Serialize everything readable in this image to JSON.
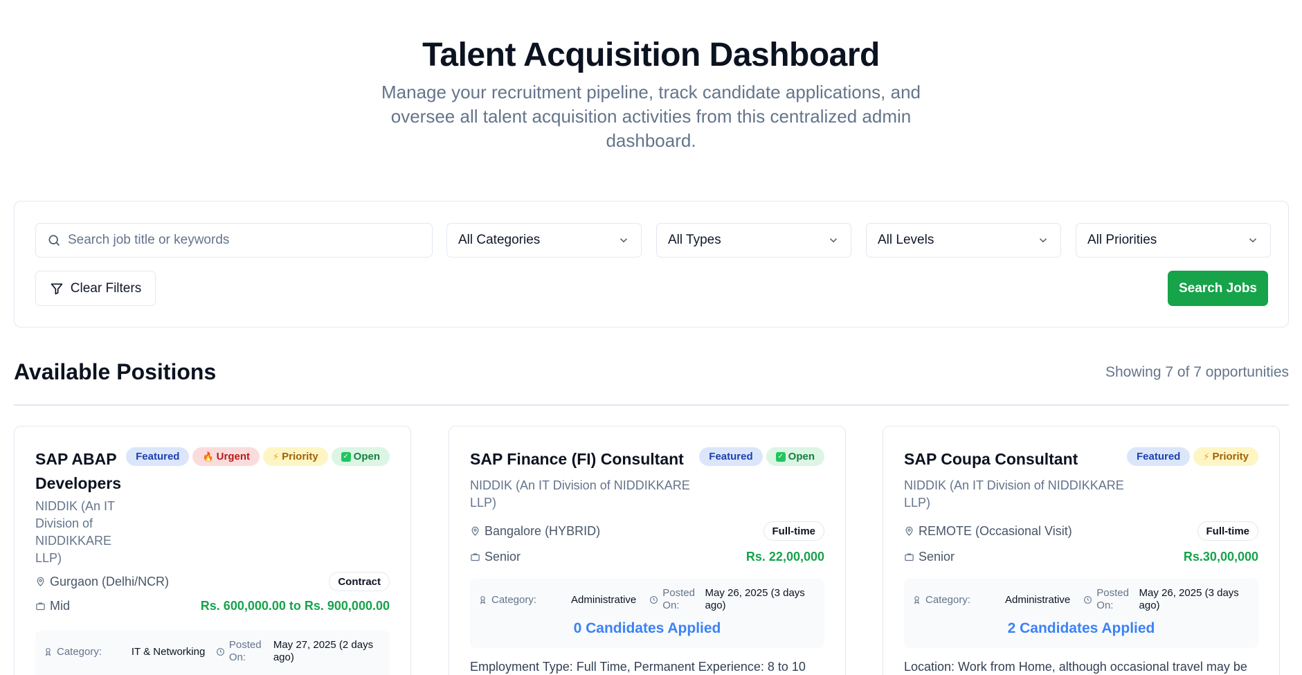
{
  "header": {
    "title": "Talent Acquisition Dashboard",
    "subtitle": "Manage your recruitment pipeline, track candidate applications, and oversee all talent acquisition activities from this centralized admin dashboard."
  },
  "filters": {
    "search_placeholder": "Search job title or keywords",
    "category": "All Categories",
    "type": "All Types",
    "level": "All Levels",
    "priority": "All Priorities",
    "clear_label": "Clear Filters",
    "search_label": "Search Jobs"
  },
  "positions": {
    "heading": "Available Positions",
    "count_text": "Showing 7 of 7 opportunities"
  },
  "labels": {
    "category": "Category:",
    "posted": "Posted On:"
  },
  "jobs": [
    {
      "title": "SAP ABAP Developers",
      "company": "NIDDIK (An IT Division of NIDDIKKARE LLP)",
      "badges": [
        "Featured",
        "Urgent",
        "Priority",
        "Open"
      ],
      "location": "Gurgaon (Delhi/NCR)",
      "job_type": "Contract",
      "level": "Mid",
      "salary": "Rs. 600,000.00 to Rs. 900,000.00",
      "category": "IT & Networking",
      "posted": "May 27, 2025 (2 days ago)",
      "applied": "",
      "description": ""
    },
    {
      "title": "SAP Finance (FI) Consultant",
      "company": "NIDDIK (An IT Division of NIDDIKKARE LLP)",
      "badges": [
        "Featured",
        "Open"
      ],
      "location": "Bangalore (HYBRID)",
      "job_type": "Full-time",
      "level": "Senior",
      "salary": "Rs. 22,00,000",
      "category": "Administrative",
      "posted": "May 26, 2025 (3 days ago)",
      "applied": "0 Candidates Applied",
      "description": "Employment Type: Full Time, Permanent Experience: 8 to 10"
    },
    {
      "title": "SAP Coupa Consultant",
      "company": "NIDDIK (An IT Division of NIDDIKKARE LLP)",
      "badges": [
        "Featured",
        "Priority"
      ],
      "location": "REMOTE (Occasional Visit)",
      "job_type": "Full-time",
      "level": "Senior",
      "salary": "Rs.30,00,000",
      "category": "Administrative",
      "posted": "May 26, 2025 (3 days ago)",
      "applied": "2 Candidates Applied",
      "description": "Location: Work from Home, although occasional travel may be"
    }
  ],
  "colors": {
    "accent_green": "#16a34a",
    "link_blue": "#3b82f6",
    "muted_text": "#64748b"
  }
}
